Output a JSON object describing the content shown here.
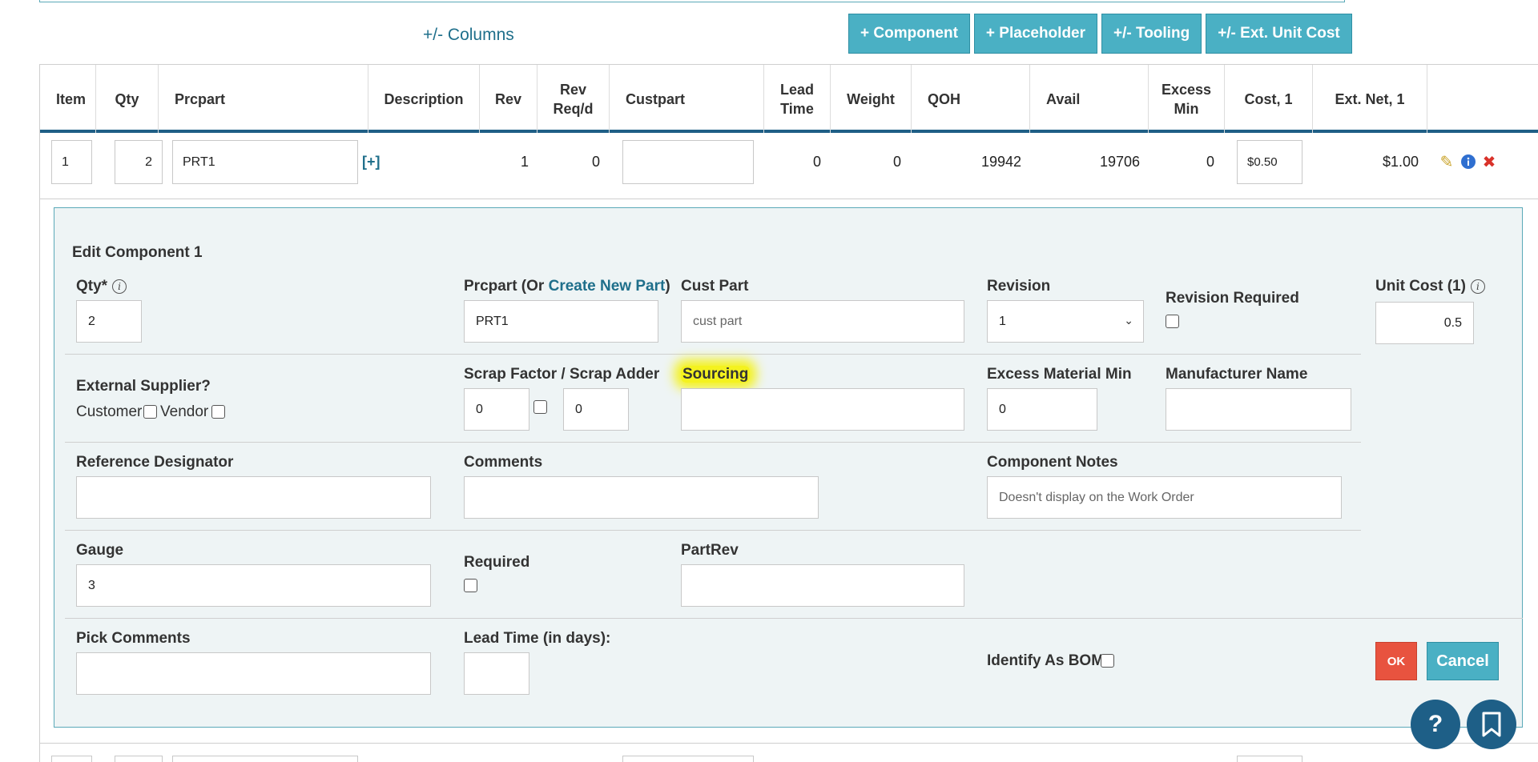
{
  "toolbar": {
    "columns_link": "+/- Columns",
    "buttons": [
      "+ Component",
      "+ Placeholder",
      "+/- Tooling",
      "+/- Ext. Unit Cost"
    ]
  },
  "table": {
    "headers": [
      "Item",
      "Qty",
      "Prcpart",
      "Description",
      "Rev",
      "Rev\nReq/d",
      "Custpart",
      "Lead\nTime",
      "Weight",
      "QOH",
      "Avail",
      "Excess\nMin",
      "Cost, 1",
      "Ext. Net, 1"
    ],
    "row": {
      "item": "1",
      "qty": "2",
      "prcpart": "PRT1",
      "expand": "[+]",
      "rev": "1",
      "rev_reqd": "0",
      "custpart": "",
      "lead_time": "0",
      "weight": "0",
      "qoh": "19942",
      "avail": "19706",
      "excess_min": "0",
      "cost": "$0.50",
      "ext_net": "$1.00"
    }
  },
  "edit": {
    "title": "Edit Component 1",
    "qty_label": "Qty*",
    "qty_value": "2",
    "prcpart_label_prefix": "Prcpart (Or ",
    "prcpart_link": "Create New Part",
    "prcpart_label_suffix": ")",
    "prcpart_value": "PRT1",
    "custpart_label": "Cust Part",
    "custpart_placeholder": "cust part",
    "revision_label": "Revision",
    "revision_value": "1",
    "revision_required_label": "Revision Required",
    "unit_cost_label": "Unit Cost (1)",
    "unit_cost_value": "0.5",
    "external_supplier_label": "External Supplier?",
    "customer_label": "Customer",
    "vendor_label": "Vendor",
    "scrap_label": "Scrap Factor / Scrap Adder",
    "scrap_factor_value": "0",
    "scrap_adder_value": "0",
    "sourcing_label": "Sourcing",
    "sourcing_value": "",
    "excess_label": "Excess Material Min",
    "excess_value": "0",
    "manufacturer_label": "Manufacturer Name",
    "manufacturer_value": "",
    "refdes_label": "Reference Designator",
    "comments_label": "Comments",
    "notes_label": "Component Notes",
    "notes_placeholder": "Doesn't display on the Work Order",
    "gauge_label": "Gauge",
    "gauge_value": "3",
    "required_label": "Required",
    "partrev_label": "PartRev",
    "pick_comments_label": "Pick Comments",
    "lead_time_label": "Lead Time (in days):",
    "identify_bom_label": "Identify As BOM:",
    "ok_label": "OK",
    "cancel_label": "Cancel"
  },
  "fab": {
    "help_glyph": "?"
  },
  "colors": {
    "accent": "#4ab0c4",
    "header_rule": "#1f5f86",
    "danger": "#e8533f",
    "highlight": "#f4f21f"
  }
}
